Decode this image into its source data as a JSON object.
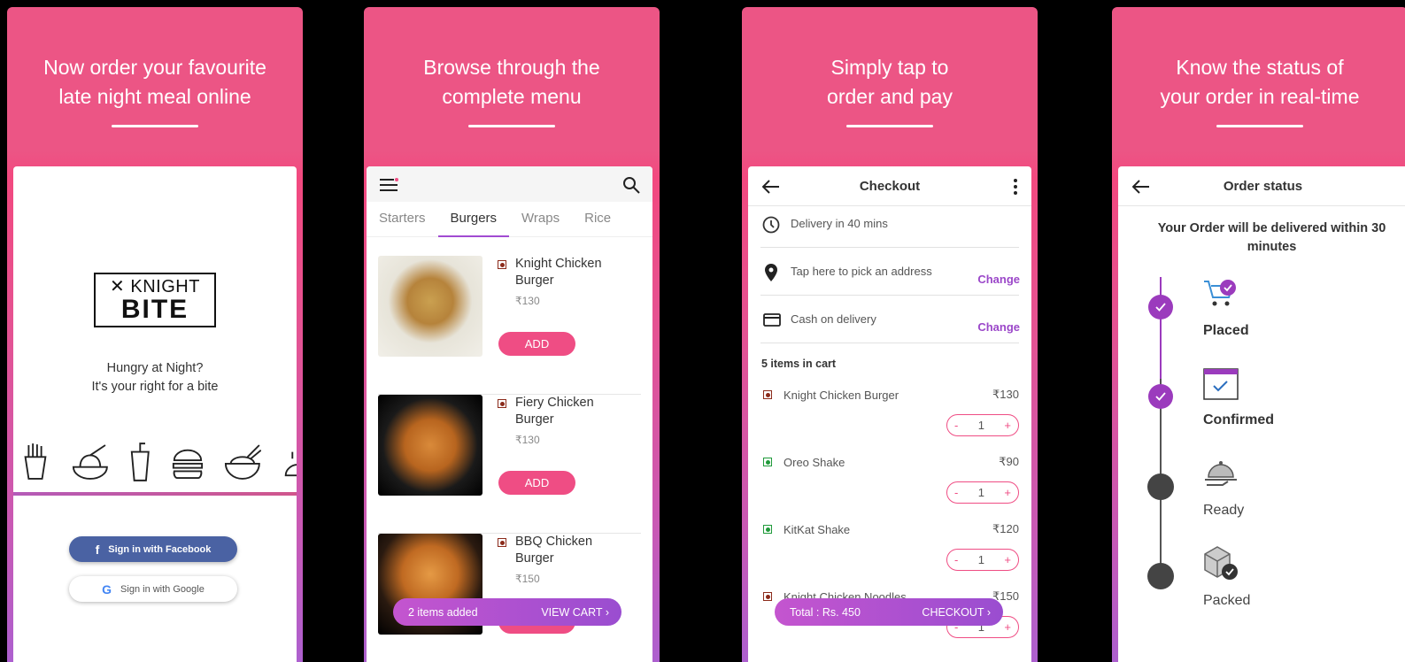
{
  "panels": [
    {
      "headline_line1": "Now order your favourite",
      "headline_line2": "late night meal online"
    },
    {
      "headline_line1": "Browse through the",
      "headline_line2": "complete menu"
    },
    {
      "headline_line1": "Simply tap to",
      "headline_line2": "order and pay"
    },
    {
      "headline_line1": "Know the status of",
      "headline_line2": "your order in real-time"
    }
  ],
  "login": {
    "logo_top": "KNIGHT",
    "logo_bottom": "BITE",
    "tagline_1": "Hungry at Night?",
    "tagline_2": "It's your right for a bite",
    "facebook_label": "Sign in with Facebook",
    "google_label": "Sign in with Google"
  },
  "menu": {
    "tabs": [
      "Starters",
      "Burgers",
      "Wraps",
      "Rice"
    ],
    "active_tab": "Burgers",
    "items": [
      {
        "name": "Knight Chicken Burger",
        "price": "₹130",
        "add_label": "ADD"
      },
      {
        "name": "Fiery Chicken Burger",
        "price": "₹130",
        "add_label": "ADD"
      },
      {
        "name": "BBQ Chicken Burger",
        "price": "₹150",
        "add_label": "ADD"
      }
    ],
    "cart_bar": {
      "count_label": "2 items added",
      "action_label": "VIEW CART"
    }
  },
  "checkout": {
    "title": "Checkout",
    "delivery": "Delivery in 40 mins",
    "address": "Tap here to pick an address",
    "payment": "Cash on delivery",
    "change_label": "Change",
    "cart_heading": "5 items in cart",
    "items": [
      {
        "name": "Knight Chicken Burger",
        "price": "₹130",
        "qty": "1",
        "veg": false
      },
      {
        "name": "Oreo Shake",
        "price": "₹90",
        "qty": "1",
        "veg": true
      },
      {
        "name": "KitKat Shake",
        "price": "₹120",
        "qty": "1",
        "veg": true
      },
      {
        "name": "Knight Chicken Noodles",
        "price": "₹150",
        "qty": "1",
        "veg": false
      }
    ],
    "minus": "-",
    "plus": "+",
    "bar": {
      "total_label": "Total : Rs. 450",
      "action_label": "CHECKOUT"
    }
  },
  "order_status": {
    "title": "Order status",
    "message": "Your Order will be delivered within 30 minutes",
    "steps": [
      {
        "label": "Placed",
        "done": true
      },
      {
        "label": "Confirmed",
        "done": true
      },
      {
        "label": "Ready",
        "done": false
      },
      {
        "label": "Packed",
        "done": false
      }
    ]
  },
  "colors": {
    "brand_pink": "#ec5585",
    "accent_purple": "#9b47c9",
    "add_pink": "#ef4d84",
    "facebook_blue": "#4a62a3",
    "nonveg_red": "#8b2a1a",
    "veg_green": "#1f9a3a"
  }
}
